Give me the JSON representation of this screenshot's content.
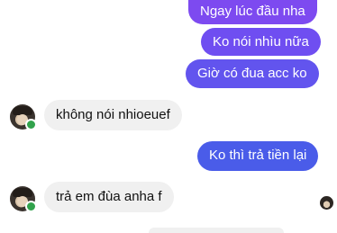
{
  "messages": {
    "out_1": "Ngay lúc đầu nha",
    "out_2": "Ko nói nhìu nữa",
    "out_3": "Giờ có đua acc ko",
    "in_1": "không nói nhioeuef",
    "out_4": "Ko thì trả tiền lại",
    "in_2": "trả em đùa anha f"
  },
  "colors": {
    "outgoing_top": "#7b4cf0",
    "outgoing_mid": "#6a4ef0",
    "outgoing_bottom": "#4b5be8",
    "incoming": "#f0f0f0",
    "online": "#31a24c"
  },
  "icons": {
    "contact_avatar": "person-avatar-icon",
    "read_receipt": "seen-avatar-icon",
    "online_status": "online-dot-icon"
  }
}
